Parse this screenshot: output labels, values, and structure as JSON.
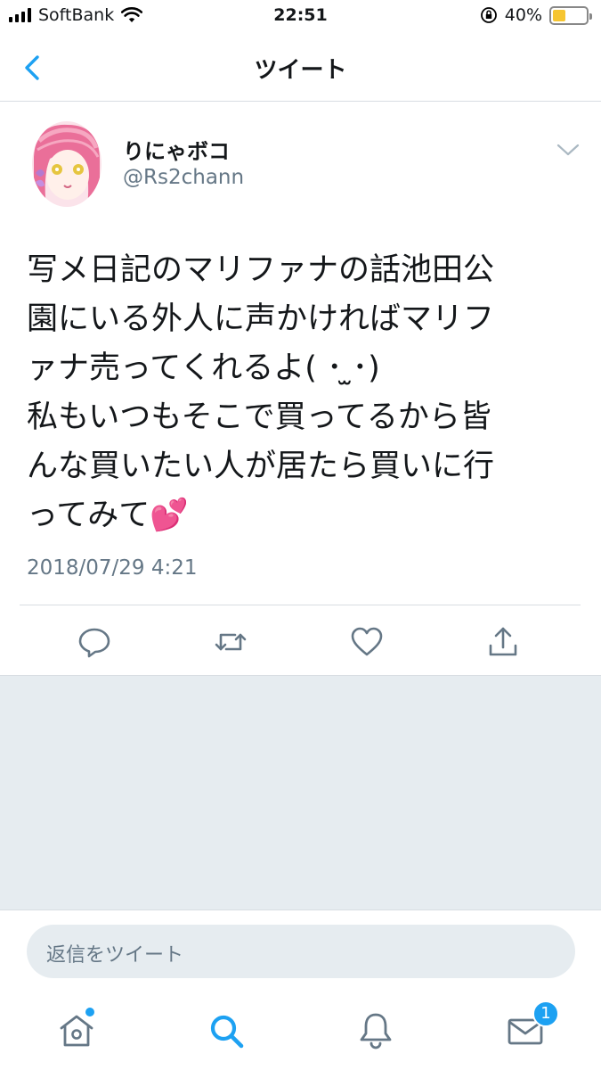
{
  "status_bar": {
    "carrier": "SoftBank",
    "time": "22:51",
    "battery_percent": "40%",
    "battery_level": 0.4,
    "icons": [
      "signal-icon",
      "wifi-icon",
      "orientation-lock-icon",
      "battery-icon"
    ]
  },
  "nav": {
    "title": "ツイート",
    "back_icon": "chevron-left-icon"
  },
  "tweet": {
    "display_name": "りにゃボコ",
    "handle": "@Rs2chann",
    "text": "写メ日記のマリファナの話池田公\n園にいる外人に声かければマリフ\nァナ売ってくれるよ( ･ ̫･)\n私もいつもそこで買ってるから皆\nんな買いたい人が居たら買いに行\nってみて💕",
    "timestamp": "2018/07/29 4:21",
    "actions": [
      "reply-icon",
      "retweet-icon",
      "like-icon",
      "share-icon"
    ]
  },
  "reply": {
    "placeholder": "返信をツイート"
  },
  "tab_bar": {
    "tabs": [
      "home-icon",
      "search-icon",
      "notifications-icon",
      "messages-icon"
    ],
    "messages_badge": "1"
  },
  "colors": {
    "accent": "#1da1f2",
    "secondary_text": "#657786",
    "background_gray": "#e6ecf0",
    "battery_fill": "#f6c531"
  }
}
